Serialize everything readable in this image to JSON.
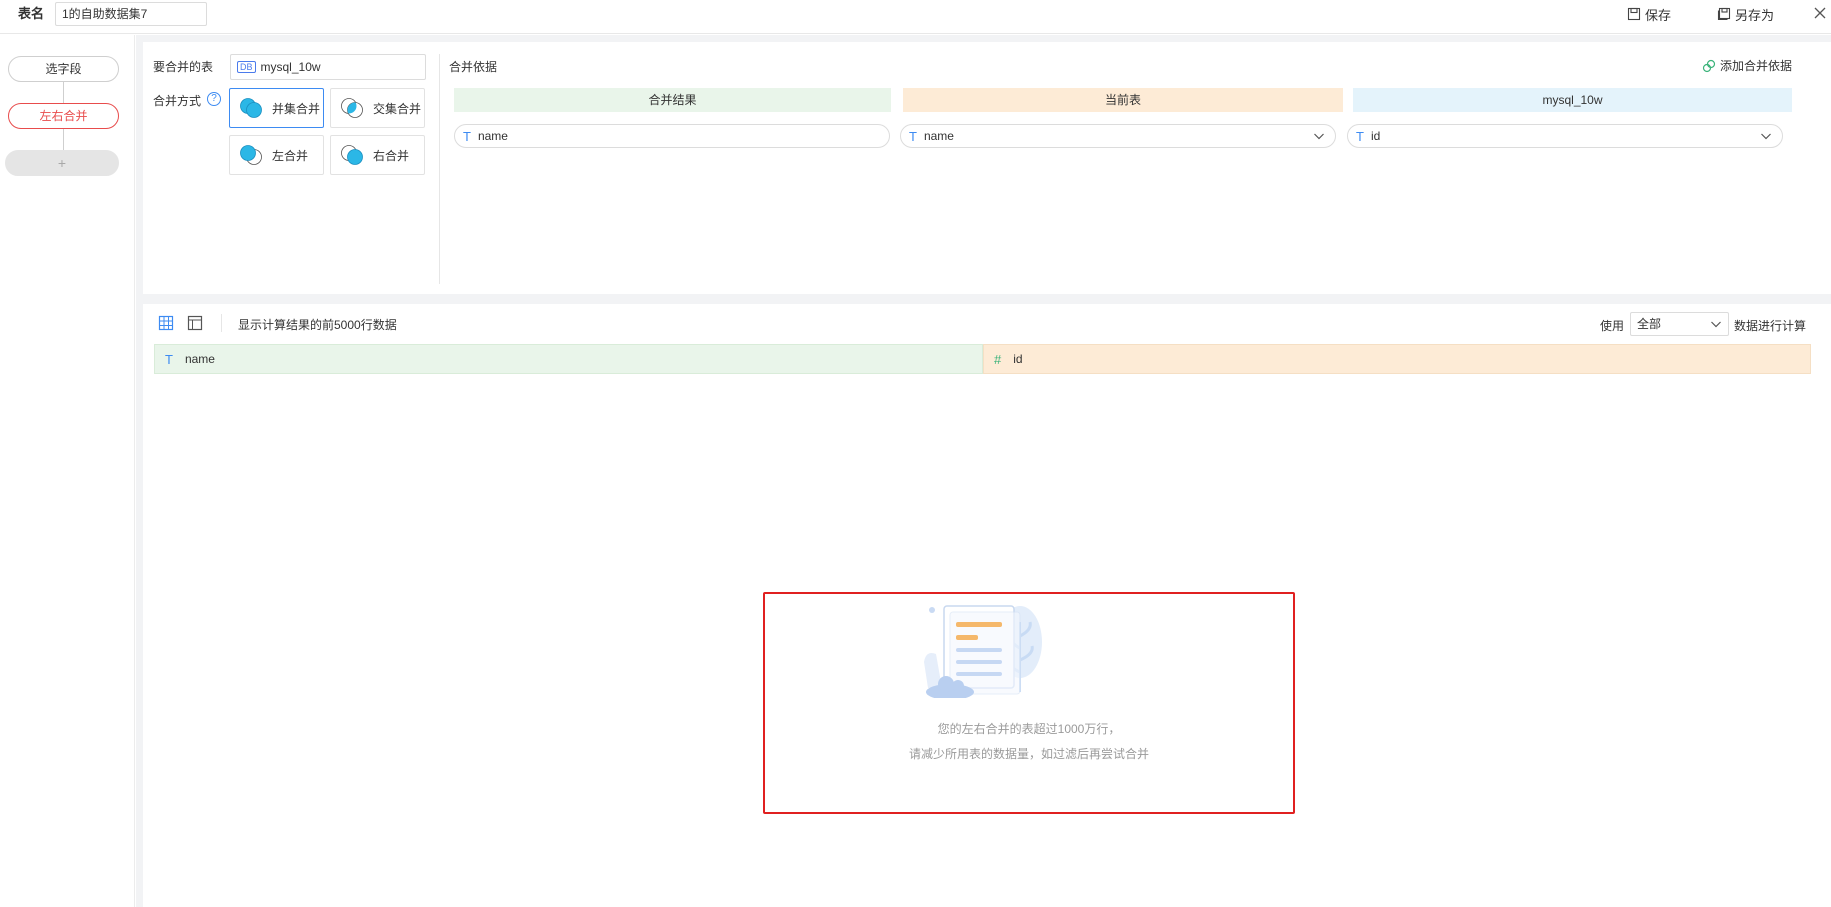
{
  "header": {
    "table_name_label": "表名",
    "table_name_value": "1的自助数据集7",
    "save_label": "保存",
    "save_as_label": "另存为"
  },
  "flow": {
    "nodes": [
      {
        "label": "选字段",
        "state": "normal"
      },
      {
        "label": "左右合并",
        "state": "active"
      },
      {
        "label": "+",
        "state": "add"
      }
    ]
  },
  "merge_config": {
    "table_label": "要合并的表",
    "table_badge": "DB",
    "table_value": "mysql_10w",
    "method_label": "合并方式",
    "help_icon_glyph": "?",
    "methods": [
      {
        "label": "并集合并",
        "selected": true,
        "icon": "union-merge-icon"
      },
      {
        "label": "交集合并",
        "selected": false,
        "icon": "intersect-merge-icon"
      },
      {
        "label": "左合并",
        "selected": false,
        "icon": "left-merge-icon"
      },
      {
        "label": "右合并",
        "selected": false,
        "icon": "right-merge-icon"
      }
    ]
  },
  "merge_basis": {
    "title": "合并依据",
    "add_label": "添加合并依据",
    "columns": [
      {
        "header": "合并结果",
        "color": "#e9f5ea",
        "field_type": "T",
        "field": "name",
        "dropdown": false
      },
      {
        "header": "当前表",
        "color": "#fdebd6",
        "field_type": "T",
        "field": "name",
        "dropdown": true
      },
      {
        "header": "mysql_10w",
        "color": "#e4f3fb",
        "field_type": "T",
        "field": "id",
        "dropdown": true
      }
    ]
  },
  "preview": {
    "info_text": "显示计算结果的前5000行数据",
    "use_label": "使用",
    "use_value": "全部",
    "calc_label": "数据进行计算",
    "columns": [
      {
        "type_glyph": "T",
        "name": "name",
        "color": "#e9f5ea"
      },
      {
        "type_glyph": "#",
        "name": "id",
        "color": "#fdebd6"
      }
    ]
  },
  "notice": {
    "line1": "您的左右合并的表超过1000万行，",
    "line2": "请减少所用表的数据量，如过滤后再尝试合并"
  },
  "colors": {
    "accent_blue": "#3d8bf2",
    "active_red": "#e84c4c",
    "notice_border": "#e02020"
  }
}
